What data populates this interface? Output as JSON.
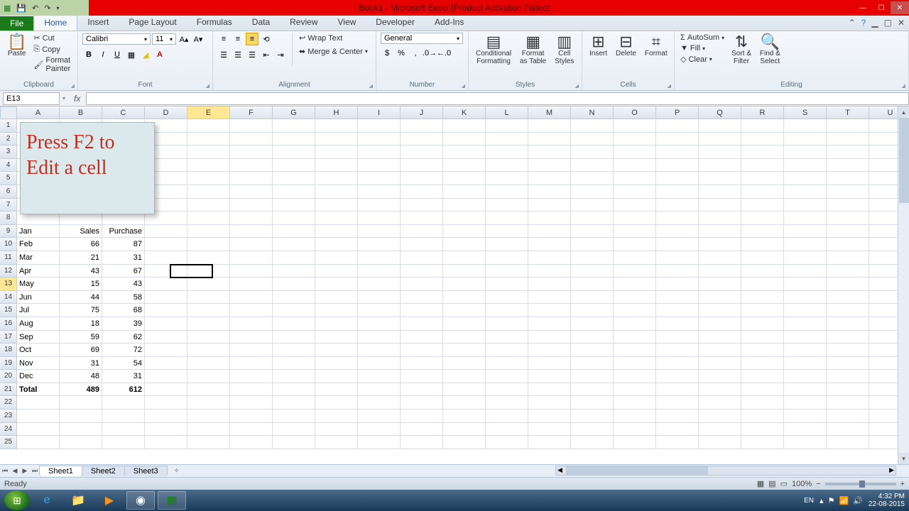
{
  "title": "Book1 - Microsoft Excel (Product Activation Failed)",
  "tabs": {
    "file": "File",
    "list": [
      "Home",
      "Insert",
      "Page Layout",
      "Formulas",
      "Data",
      "Review",
      "View",
      "Developer",
      "Add-Ins"
    ],
    "active": "Home"
  },
  "ribbon": {
    "clipboard": {
      "label": "Clipboard",
      "paste": "Paste",
      "cut": "Cut",
      "copy": "Copy",
      "painter": "Format Painter"
    },
    "font": {
      "label": "Font",
      "name": "Calibri",
      "size": "11"
    },
    "alignment": {
      "label": "Alignment",
      "wrap": "Wrap Text",
      "merge": "Merge & Center"
    },
    "number": {
      "label": "Number",
      "format": "General"
    },
    "styles": {
      "label": "Styles",
      "cond": "Conditional\nFormatting",
      "table": "Format\nas Table",
      "cell": "Cell\nStyles"
    },
    "cells": {
      "label": "Cells",
      "insert": "Insert",
      "delete": "Delete",
      "format": "Format"
    },
    "editing": {
      "label": "Editing",
      "autosum": "AutoSum",
      "fill": "Fill",
      "clear": "Clear",
      "sort": "Sort &\nFilter",
      "find": "Find &\nSelect"
    }
  },
  "namebox": "E13",
  "columns": [
    "A",
    "B",
    "C",
    "D",
    "E",
    "F",
    "G",
    "H",
    "I",
    "J",
    "K",
    "L",
    "M",
    "N",
    "O",
    "P",
    "Q",
    "R",
    "S",
    "T",
    "U"
  ],
  "active_col_index": 4,
  "active_row": 13,
  "row_count": 25,
  "callout": {
    "line1": "Press F2 to",
    "line2": "Edit a cell"
  },
  "table": {
    "header_row": 9,
    "headers": [
      "Jan",
      "Sales",
      "Purchase"
    ],
    "rows": [
      {
        "r": 10,
        "a": "Feb",
        "b": 66,
        "c": 87
      },
      {
        "r": 11,
        "a": "Mar",
        "b": 21,
        "c": 31
      },
      {
        "r": 12,
        "a": "Apr",
        "b": 43,
        "c": 67
      },
      {
        "r": 13,
        "a": "May",
        "b": 15,
        "c": 43
      },
      {
        "r": 14,
        "a": "Jun",
        "b": 44,
        "c": 58
      },
      {
        "r": 15,
        "a": "Jul",
        "b": 75,
        "c": 68
      },
      {
        "r": 16,
        "a": "Aug",
        "b": 18,
        "c": 39
      },
      {
        "r": 17,
        "a": "Sep",
        "b": 59,
        "c": 62
      },
      {
        "r": 18,
        "a": "Oct",
        "b": 69,
        "c": 72
      },
      {
        "r": 19,
        "a": "Nov",
        "b": 31,
        "c": 54
      },
      {
        "r": 20,
        "a": "Dec",
        "b": 48,
        "c": 31
      }
    ],
    "total_row": 21,
    "total": {
      "a": "Total",
      "b": 489,
      "c": 612
    }
  },
  "sheets": [
    "Sheet1",
    "Sheet2",
    "Sheet3"
  ],
  "active_sheet": "Sheet1",
  "status": "Ready",
  "zoom": "100%",
  "taskbar": {
    "lang": "EN",
    "time": "4:32 PM",
    "date": "22-08-2015"
  }
}
